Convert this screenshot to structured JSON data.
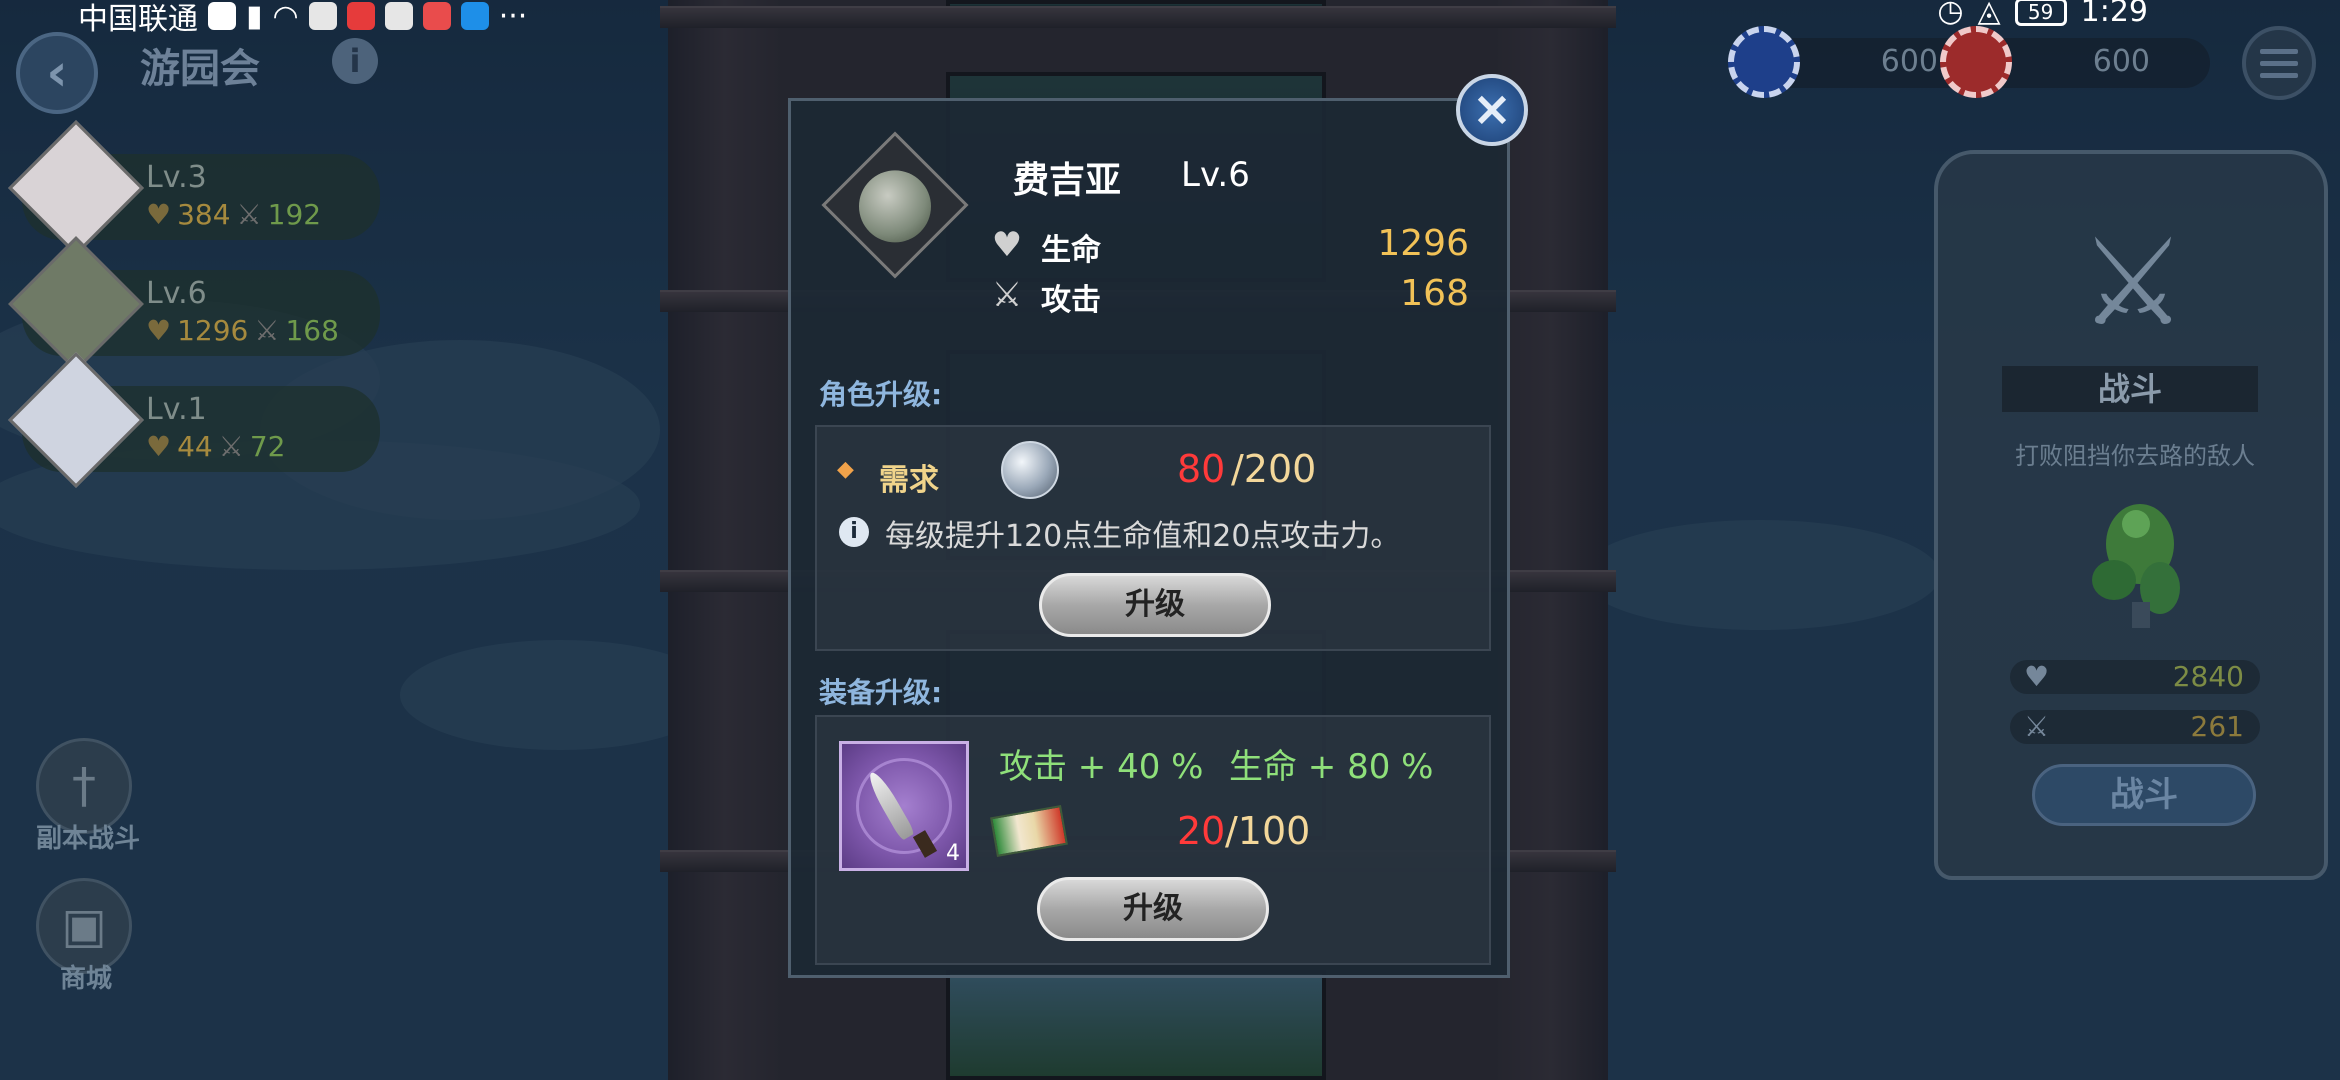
{
  "status_bar": {
    "carrier": "中国联通",
    "time": "1:29",
    "battery": "59"
  },
  "header": {
    "title": "游园会"
  },
  "party": [
    {
      "level": "Lv.3",
      "hp": "384",
      "atk": "192"
    },
    {
      "level": "Lv.6",
      "hp": "1296",
      "atk": "168"
    },
    {
      "level": "Lv.1",
      "hp": "44",
      "atk": "72"
    }
  ],
  "side_buttons": {
    "dungeon_label": "副本战斗",
    "shop_label": "商城"
  },
  "currencies": {
    "blue_chip": "600",
    "red_chip": "600"
  },
  "battle_panel": {
    "title": "战斗",
    "subtitle": "打败阻挡你去路的敌人",
    "enemy_hp": "2840",
    "enemy_atk": "261",
    "button_label": "战斗"
  },
  "modal": {
    "hero_name": "费吉亚",
    "hero_level": "Lv.6",
    "hp_label": "生命",
    "hp_value": "1296",
    "atk_label": "攻击",
    "atk_value": "168",
    "role_upgrade": {
      "title": "角色升级:",
      "requirement_label": "需求",
      "current": "80",
      "required": "/200",
      "info": "每级提升120点生命值和20点攻击力。",
      "button_label": "升级"
    },
    "equip_upgrade": {
      "title": "装备升级:",
      "item_count": "4",
      "atk_bonus": "攻击 + 40 %",
      "hp_bonus": "生命 + 80 %",
      "current": "20",
      "required": "/100",
      "button_label": "升级"
    }
  },
  "colors": {
    "hp_value": "#f2c257",
    "deficit": "#ff3a3a",
    "bonus": "#8fe07a",
    "section_title": "#8fb6de"
  }
}
